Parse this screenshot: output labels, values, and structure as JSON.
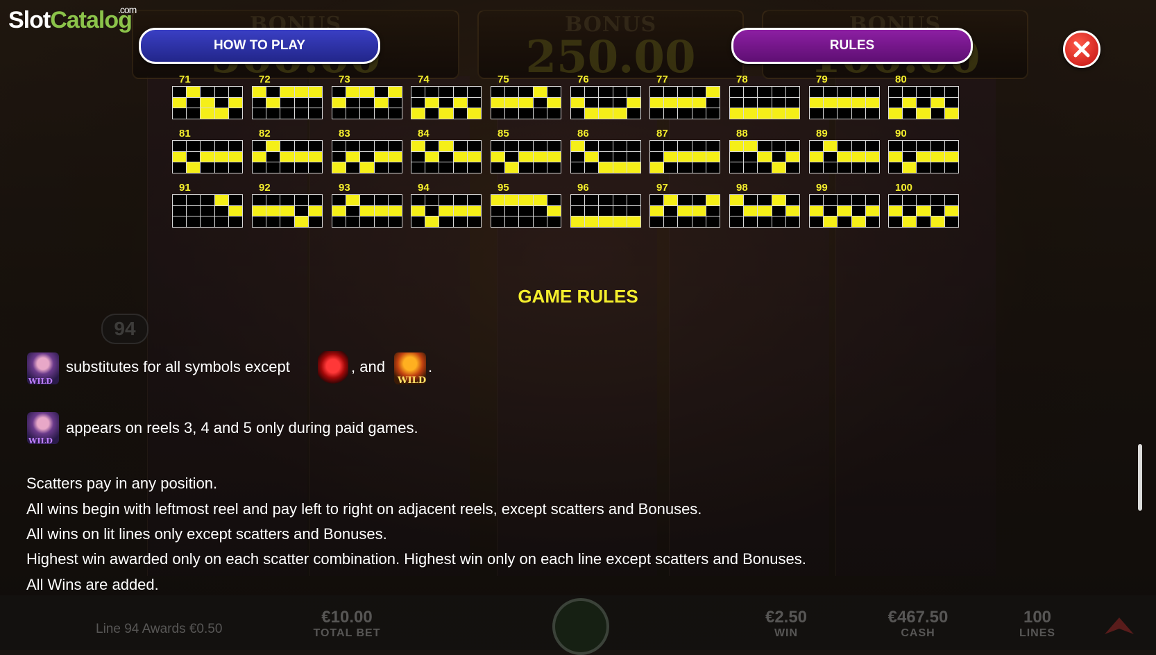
{
  "app": {
    "logo_main": "Slot",
    "logo_accent": "Catalog",
    "logo_suffix": ".com"
  },
  "background": {
    "bonus_panels": [
      {
        "label": "BONUS",
        "value": "500.00"
      },
      {
        "label": "BONUS",
        "value": "250.00"
      },
      {
        "label": "BONUS",
        "value": "100.00"
      }
    ],
    "line_indicator": "94"
  },
  "nav": {
    "how_to_play": "HOW TO PLAY",
    "rules": "RULES"
  },
  "paylines": [
    {
      "n": "71",
      "p": [
        0,
        1,
        0,
        0,
        0,
        1,
        0,
        1,
        0,
        1,
        0,
        0,
        1,
        1,
        0
      ]
    },
    {
      "n": "72",
      "p": [
        1,
        0,
        1,
        1,
        1,
        0,
        1,
        0,
        0,
        0,
        0,
        0,
        0,
        0,
        0
      ]
    },
    {
      "n": "73",
      "p": [
        0,
        1,
        1,
        0,
        1,
        1,
        0,
        0,
        1,
        0,
        0,
        0,
        0,
        0,
        0
      ]
    },
    {
      "n": "74",
      "p": [
        0,
        0,
        0,
        0,
        0,
        0,
        1,
        0,
        1,
        0,
        1,
        0,
        1,
        0,
        1
      ]
    },
    {
      "n": "75",
      "p": [
        0,
        0,
        0,
        1,
        0,
        1,
        1,
        1,
        0,
        1,
        0,
        0,
        0,
        0,
        0
      ]
    },
    {
      "n": "76",
      "p": [
        0,
        0,
        0,
        0,
        0,
        1,
        0,
        0,
        0,
        1,
        0,
        1,
        1,
        1,
        0
      ]
    },
    {
      "n": "77",
      "p": [
        0,
        0,
        0,
        0,
        1,
        1,
        1,
        1,
        1,
        0,
        0,
        0,
        0,
        0,
        0
      ]
    },
    {
      "n": "78",
      "p": [
        0,
        0,
        0,
        0,
        0,
        0,
        0,
        0,
        0,
        0,
        1,
        1,
        1,
        1,
        1
      ]
    },
    {
      "n": "79",
      "p": [
        0,
        0,
        0,
        0,
        0,
        1,
        1,
        1,
        1,
        1,
        0,
        0,
        0,
        0,
        0
      ]
    },
    {
      "n": "80",
      "p": [
        0,
        0,
        0,
        0,
        0,
        0,
        1,
        0,
        1,
        0,
        1,
        0,
        1,
        0,
        1
      ]
    },
    {
      "n": "81",
      "p": [
        0,
        0,
        0,
        0,
        0,
        1,
        0,
        1,
        1,
        1,
        0,
        1,
        0,
        0,
        0
      ]
    },
    {
      "n": "82",
      "p": [
        0,
        1,
        0,
        0,
        0,
        1,
        0,
        1,
        1,
        1,
        0,
        0,
        0,
        0,
        0
      ]
    },
    {
      "n": "83",
      "p": [
        0,
        0,
        0,
        0,
        0,
        0,
        1,
        0,
        1,
        1,
        1,
        0,
        1,
        0,
        0
      ]
    },
    {
      "n": "84",
      "p": [
        1,
        0,
        1,
        0,
        0,
        0,
        1,
        0,
        1,
        1,
        0,
        0,
        0,
        0,
        0
      ]
    },
    {
      "n": "85",
      "p": [
        0,
        0,
        0,
        0,
        0,
        1,
        0,
        1,
        1,
        1,
        0,
        1,
        0,
        0,
        0
      ]
    },
    {
      "n": "86",
      "p": [
        1,
        0,
        0,
        0,
        0,
        0,
        1,
        0,
        0,
        0,
        0,
        0,
        1,
        1,
        1
      ]
    },
    {
      "n": "87",
      "p": [
        0,
        0,
        0,
        0,
        0,
        0,
        1,
        1,
        1,
        1,
        1,
        0,
        0,
        0,
        0
      ]
    },
    {
      "n": "88",
      "p": [
        1,
        1,
        0,
        0,
        0,
        0,
        0,
        1,
        0,
        1,
        0,
        0,
        0,
        1,
        0
      ]
    },
    {
      "n": "89",
      "p": [
        0,
        1,
        0,
        0,
        0,
        1,
        0,
        1,
        1,
        1,
        0,
        0,
        0,
        0,
        0
      ]
    },
    {
      "n": "90",
      "p": [
        0,
        0,
        0,
        0,
        0,
        1,
        0,
        1,
        1,
        1,
        0,
        1,
        0,
        0,
        0
      ]
    },
    {
      "n": "91",
      "p": [
        0,
        0,
        0,
        1,
        0,
        0,
        0,
        0,
        0,
        1,
        0,
        0,
        0,
        0,
        0
      ]
    },
    {
      "n": "92",
      "p": [
        0,
        0,
        0,
        0,
        0,
        1,
        1,
        1,
        0,
        1,
        0,
        0,
        0,
        1,
        0
      ]
    },
    {
      "n": "93",
      "p": [
        0,
        1,
        0,
        0,
        0,
        1,
        0,
        1,
        1,
        1,
        0,
        0,
        0,
        0,
        0
      ]
    },
    {
      "n": "94",
      "p": [
        0,
        0,
        0,
        0,
        0,
        1,
        0,
        1,
        1,
        1,
        0,
        1,
        0,
        0,
        0
      ]
    },
    {
      "n": "95",
      "p": [
        1,
        1,
        1,
        1,
        0,
        0,
        0,
        0,
        0,
        1,
        0,
        0,
        0,
        0,
        0
      ]
    },
    {
      "n": "96",
      "p": [
        0,
        0,
        0,
        0,
        0,
        0,
        0,
        0,
        0,
        0,
        1,
        1,
        1,
        1,
        1
      ]
    },
    {
      "n": "97",
      "p": [
        0,
        1,
        0,
        0,
        1,
        1,
        0,
        1,
        1,
        0,
        0,
        0,
        0,
        0,
        0
      ]
    },
    {
      "n": "98",
      "p": [
        1,
        0,
        0,
        1,
        0,
        0,
        1,
        1,
        0,
        1,
        0,
        0,
        0,
        0,
        0
      ]
    },
    {
      "n": "99",
      "p": [
        0,
        0,
        0,
        0,
        0,
        1,
        0,
        1,
        0,
        1,
        0,
        1,
        0,
        1,
        0
      ]
    },
    {
      "n": "100",
      "p": [
        0,
        0,
        0,
        0,
        0,
        1,
        0,
        1,
        0,
        1,
        0,
        1,
        0,
        1,
        0
      ]
    }
  ],
  "rules": {
    "title": "GAME RULES",
    "substitutes_text": "substitutes for all symbols except",
    "substitutes_and": ", and",
    "substitutes_end": ".",
    "appears_text": "appears on reels 3, 4 and 5 only during paid games.",
    "lines": [
      "Scatters pay in any position.",
      "All wins begin with leftmost reel and pay left to right on adjacent reels, except scatters and Bonuses.",
      "All wins on lit lines only except scatters and Bonuses.",
      "Highest win awarded only on each scatter combination. Highest win only on each line except scatters and Bonuses.",
      "All Wins are added."
    ]
  },
  "bottom_bar": {
    "award": "Line 94 Awards €0.50",
    "total_bet_value": "€10.00",
    "total_bet_label": "TOTAL BET",
    "win_value": "€2.50",
    "win_label": "WIN",
    "cash_value": "€467.50",
    "cash_label": "CASH",
    "lines_value": "100",
    "lines_label": "LINES"
  }
}
